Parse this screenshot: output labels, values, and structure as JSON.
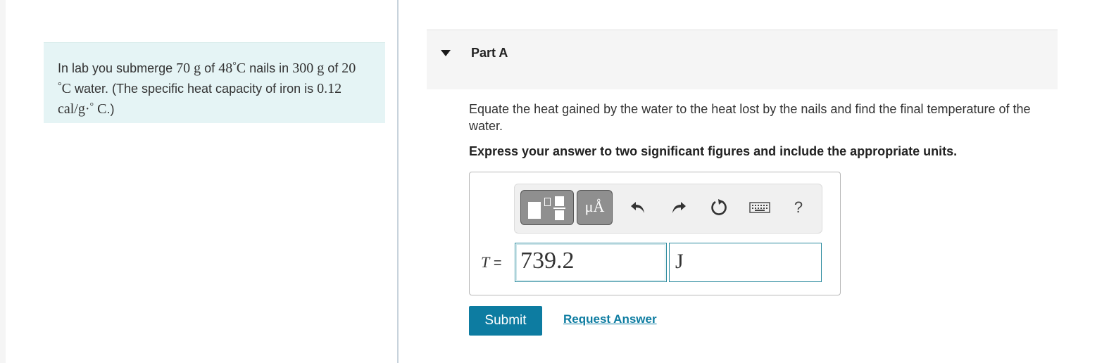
{
  "problem": {
    "t1": "In lab you submerge",
    "mass_nails": "70",
    "unit_g": "g",
    "t2": "of",
    "temp_nails": "48",
    "deg": "°",
    "unit_C": "C",
    "t3": "nails in",
    "mass_water": "300",
    "t4": "of",
    "temp_water": "20",
    "t5": "water. (The specific heat capacity of iron is",
    "specific_heat": "0.12",
    "heat_unit": "cal/g",
    "dot": "·",
    "t6": ".)"
  },
  "part": {
    "title": "Part A",
    "instruction": "Equate the heat gained by the water to the heat lost by the nails and find the final temperature of the water.",
    "express": "Express your answer to two significant figures and include the appropriate units."
  },
  "toolbar": {
    "units_label": "μÅ",
    "help_label": "?"
  },
  "answer": {
    "variable": "T",
    "equals": "=",
    "value": "739.2",
    "unit": "J"
  },
  "actions": {
    "submit_label": "Submit",
    "request_label": "Request Answer"
  },
  "colors": {
    "accent": "#0d7ca1",
    "problem_bg": "#e5f4f5",
    "header_bg": "#f5f5f5",
    "input_border": "#2a8a9e"
  },
  "icons": [
    "collapse-triangle-icon",
    "undo-icon",
    "redo-icon",
    "reset-icon",
    "keyboard-icon",
    "help-icon"
  ]
}
